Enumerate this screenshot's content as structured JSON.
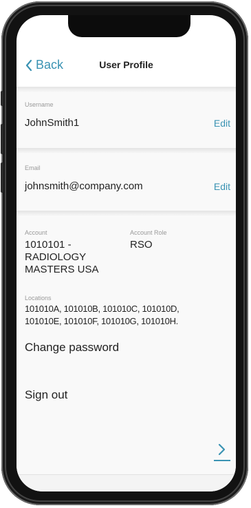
{
  "navbar": {
    "back_label": "Back",
    "title": "User Profile"
  },
  "username": {
    "label": "Username",
    "value": "JohnSmith1",
    "edit_label": "Edit"
  },
  "email": {
    "label": "Email",
    "value": "johnsmith@company.com",
    "edit_label": "Edit"
  },
  "account": {
    "label": "Account",
    "lines": [
      "1010101 -",
      "RADIOLOGY",
      "MASTERS USA"
    ],
    "role_label": "Account Role",
    "role_value": "RSO"
  },
  "locations": {
    "label": "Locations",
    "lines": [
      "101010A, 101010B, 101010C, 101010D,",
      "101010E, 101010F, 101010G, 101010H."
    ]
  },
  "actions": {
    "change_password": "Change password",
    "sign_out": "Sign out"
  },
  "icons": {
    "back": "chevron-left-icon",
    "forward": "chevron-right-icon"
  },
  "colors": {
    "accent": "#3a93b3",
    "text": "#222222",
    "muted": "#9a9a9a"
  }
}
